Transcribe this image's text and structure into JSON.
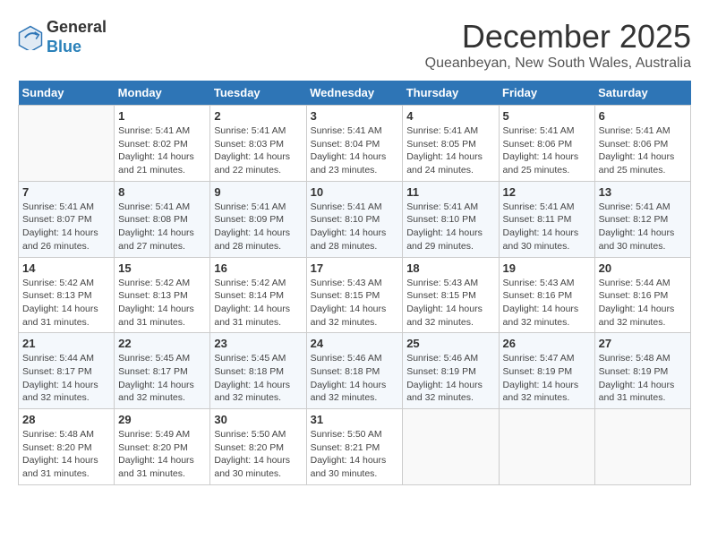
{
  "logo": {
    "line1": "General",
    "line2": "Blue"
  },
  "title": "December 2025",
  "subtitle": "Queanbeyan, New South Wales, Australia",
  "headers": [
    "Sunday",
    "Monday",
    "Tuesday",
    "Wednesday",
    "Thursday",
    "Friday",
    "Saturday"
  ],
  "weeks": [
    [
      {
        "day": "",
        "info": ""
      },
      {
        "day": "1",
        "info": "Sunrise: 5:41 AM\nSunset: 8:02 PM\nDaylight: 14 hours\nand 21 minutes."
      },
      {
        "day": "2",
        "info": "Sunrise: 5:41 AM\nSunset: 8:03 PM\nDaylight: 14 hours\nand 22 minutes."
      },
      {
        "day": "3",
        "info": "Sunrise: 5:41 AM\nSunset: 8:04 PM\nDaylight: 14 hours\nand 23 minutes."
      },
      {
        "day": "4",
        "info": "Sunrise: 5:41 AM\nSunset: 8:05 PM\nDaylight: 14 hours\nand 24 minutes."
      },
      {
        "day": "5",
        "info": "Sunrise: 5:41 AM\nSunset: 8:06 PM\nDaylight: 14 hours\nand 25 minutes."
      },
      {
        "day": "6",
        "info": "Sunrise: 5:41 AM\nSunset: 8:06 PM\nDaylight: 14 hours\nand 25 minutes."
      }
    ],
    [
      {
        "day": "7",
        "info": "Sunrise: 5:41 AM\nSunset: 8:07 PM\nDaylight: 14 hours\nand 26 minutes."
      },
      {
        "day": "8",
        "info": "Sunrise: 5:41 AM\nSunset: 8:08 PM\nDaylight: 14 hours\nand 27 minutes."
      },
      {
        "day": "9",
        "info": "Sunrise: 5:41 AM\nSunset: 8:09 PM\nDaylight: 14 hours\nand 28 minutes."
      },
      {
        "day": "10",
        "info": "Sunrise: 5:41 AM\nSunset: 8:10 PM\nDaylight: 14 hours\nand 28 minutes."
      },
      {
        "day": "11",
        "info": "Sunrise: 5:41 AM\nSunset: 8:10 PM\nDaylight: 14 hours\nand 29 minutes."
      },
      {
        "day": "12",
        "info": "Sunrise: 5:41 AM\nSunset: 8:11 PM\nDaylight: 14 hours\nand 30 minutes."
      },
      {
        "day": "13",
        "info": "Sunrise: 5:41 AM\nSunset: 8:12 PM\nDaylight: 14 hours\nand 30 minutes."
      }
    ],
    [
      {
        "day": "14",
        "info": "Sunrise: 5:42 AM\nSunset: 8:13 PM\nDaylight: 14 hours\nand 31 minutes."
      },
      {
        "day": "15",
        "info": "Sunrise: 5:42 AM\nSunset: 8:13 PM\nDaylight: 14 hours\nand 31 minutes."
      },
      {
        "day": "16",
        "info": "Sunrise: 5:42 AM\nSunset: 8:14 PM\nDaylight: 14 hours\nand 31 minutes."
      },
      {
        "day": "17",
        "info": "Sunrise: 5:43 AM\nSunset: 8:15 PM\nDaylight: 14 hours\nand 32 minutes."
      },
      {
        "day": "18",
        "info": "Sunrise: 5:43 AM\nSunset: 8:15 PM\nDaylight: 14 hours\nand 32 minutes."
      },
      {
        "day": "19",
        "info": "Sunrise: 5:43 AM\nSunset: 8:16 PM\nDaylight: 14 hours\nand 32 minutes."
      },
      {
        "day": "20",
        "info": "Sunrise: 5:44 AM\nSunset: 8:16 PM\nDaylight: 14 hours\nand 32 minutes."
      }
    ],
    [
      {
        "day": "21",
        "info": "Sunrise: 5:44 AM\nSunset: 8:17 PM\nDaylight: 14 hours\nand 32 minutes."
      },
      {
        "day": "22",
        "info": "Sunrise: 5:45 AM\nSunset: 8:17 PM\nDaylight: 14 hours\nand 32 minutes."
      },
      {
        "day": "23",
        "info": "Sunrise: 5:45 AM\nSunset: 8:18 PM\nDaylight: 14 hours\nand 32 minutes."
      },
      {
        "day": "24",
        "info": "Sunrise: 5:46 AM\nSunset: 8:18 PM\nDaylight: 14 hours\nand 32 minutes."
      },
      {
        "day": "25",
        "info": "Sunrise: 5:46 AM\nSunset: 8:19 PM\nDaylight: 14 hours\nand 32 minutes."
      },
      {
        "day": "26",
        "info": "Sunrise: 5:47 AM\nSunset: 8:19 PM\nDaylight: 14 hours\nand 32 minutes."
      },
      {
        "day": "27",
        "info": "Sunrise: 5:48 AM\nSunset: 8:19 PM\nDaylight: 14 hours\nand 31 minutes."
      }
    ],
    [
      {
        "day": "28",
        "info": "Sunrise: 5:48 AM\nSunset: 8:20 PM\nDaylight: 14 hours\nand 31 minutes."
      },
      {
        "day": "29",
        "info": "Sunrise: 5:49 AM\nSunset: 8:20 PM\nDaylight: 14 hours\nand 31 minutes."
      },
      {
        "day": "30",
        "info": "Sunrise: 5:50 AM\nSunset: 8:20 PM\nDaylight: 14 hours\nand 30 minutes."
      },
      {
        "day": "31",
        "info": "Sunrise: 5:50 AM\nSunset: 8:21 PM\nDaylight: 14 hours\nand 30 minutes."
      },
      {
        "day": "",
        "info": ""
      },
      {
        "day": "",
        "info": ""
      },
      {
        "day": "",
        "info": ""
      }
    ]
  ]
}
